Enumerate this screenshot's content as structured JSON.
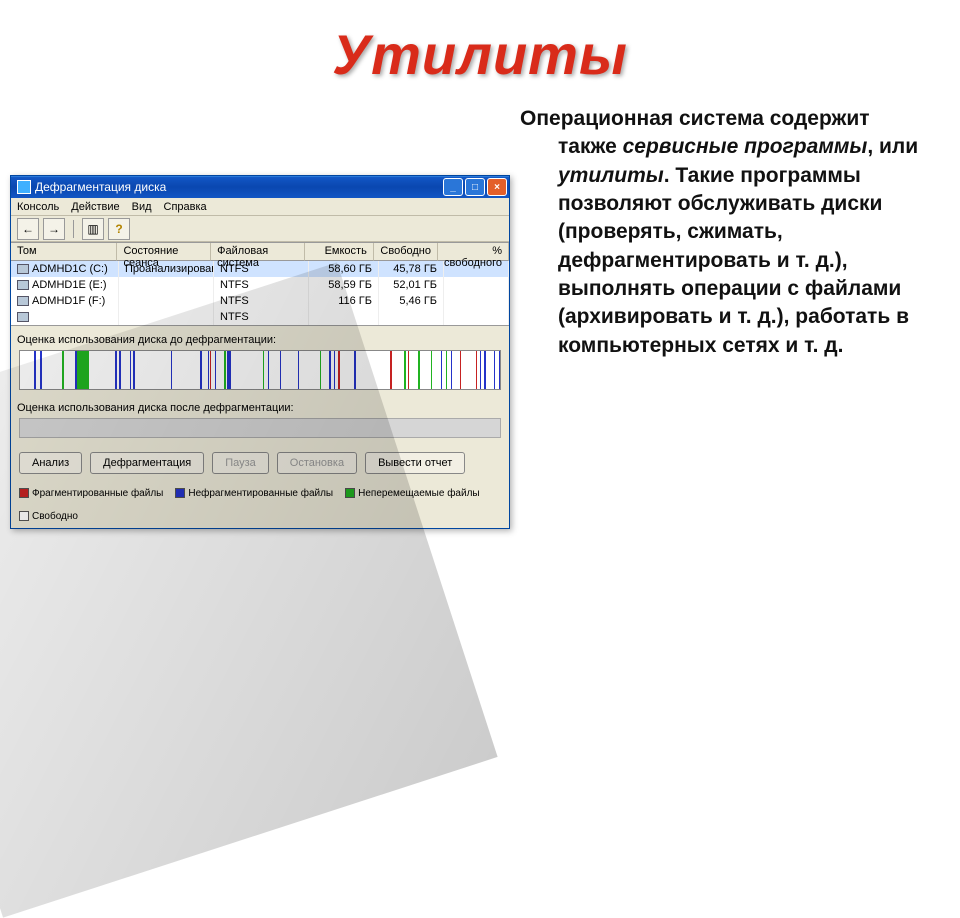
{
  "slide": {
    "title": "Утилиты",
    "body_html": "Операционная система содержит также <em>сервисные программы</em>, или <em>утилиты</em>. Такие программы позволяют обслуживать диски (проверять, сжимать, дефрагментировать и т. д.), выполнять операции с файлами (архивировать и т. д.), работать в компьютерных сетях и т. д."
  },
  "win": {
    "title": "Дефрагментация диска",
    "menu": [
      "Консоль",
      "Действие",
      "Вид",
      "Справка"
    ],
    "toolbar": {
      "back": "←",
      "fwd": "→",
      "props": "▥",
      "help": "?"
    },
    "columns": {
      "tom": "Том",
      "session": "Состояние сеанса",
      "fs": "Файловая система",
      "cap": "Емкость",
      "free": "Свободно",
      "pct": "% свободного"
    },
    "rows": [
      {
        "tom": "ADMHD1C (C:)",
        "session": "Проанализировано",
        "fs": "NTFS",
        "cap": "58,60 ГБ",
        "free": "45,78 ГБ",
        "pct": ""
      },
      {
        "tom": "ADMHD1E (E:)",
        "session": "",
        "fs": "NTFS",
        "cap": "58,59 ГБ",
        "free": "52,01 ГБ",
        "pct": ""
      },
      {
        "tom": "ADMHD1F (F:)",
        "session": "",
        "fs": "NTFS",
        "cap": "116 ГБ",
        "free": "5,46 ГБ",
        "pct": ""
      },
      {
        "tom": "",
        "session": "",
        "fs": "NTFS",
        "cap": "",
        "free": "",
        "pct": ""
      }
    ],
    "section_before": "Оценка использования диска до дефрагментации:",
    "section_after": "Оценка использования диска после дефрагментации:",
    "buttons": {
      "analyze": "Анализ",
      "defrag": "Дефрагментация",
      "pause": "Пауза",
      "stop": "Остановка",
      "report": "Вывести отчет"
    },
    "legend": {
      "frag": "Фрагментированные файлы",
      "nofrag": "Нефрагментированные файлы",
      "nomove": "Неперемещаемые файлы",
      "free": "Свободно"
    }
  }
}
